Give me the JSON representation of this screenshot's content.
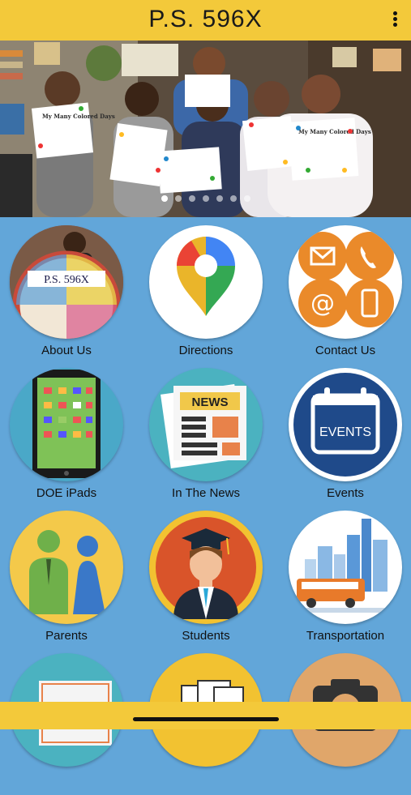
{
  "header": {
    "title": "P.S. 596X",
    "menu_icon": "more-vertical-icon"
  },
  "banner": {
    "sign_text": "My Many Colored Days",
    "school_sign": "P.S. 596X",
    "slide_count": 7,
    "active_slide": 0
  },
  "tiles": [
    {
      "label": "About Us",
      "icon": "school-photo"
    },
    {
      "label": "Directions",
      "icon": "map-pin-icon"
    },
    {
      "label": "Contact Us",
      "icon": "contact-icons"
    },
    {
      "label": "DOE iPads",
      "icon": "tablet-icon"
    },
    {
      "label": "In The News",
      "icon": "newspaper-icon"
    },
    {
      "label": "Events",
      "icon": "calendar-icon",
      "icon_text": "EVENTS"
    },
    {
      "label": "Parents",
      "icon": "parents-icon"
    },
    {
      "label": "Students",
      "icon": "graduate-icon"
    },
    {
      "label": "Transportation",
      "icon": "bus-icon"
    },
    {
      "label": "",
      "icon": "certificate-icon"
    },
    {
      "label": "",
      "icon": "documents-icon"
    },
    {
      "label": "",
      "icon": "camera-icon"
    }
  ],
  "news_text": "NEWS",
  "colors": {
    "header": "#f3c93a",
    "background": "#62a6d9",
    "accent_orange": "#ea8a2a",
    "events_blue": "#1f4a8a"
  }
}
